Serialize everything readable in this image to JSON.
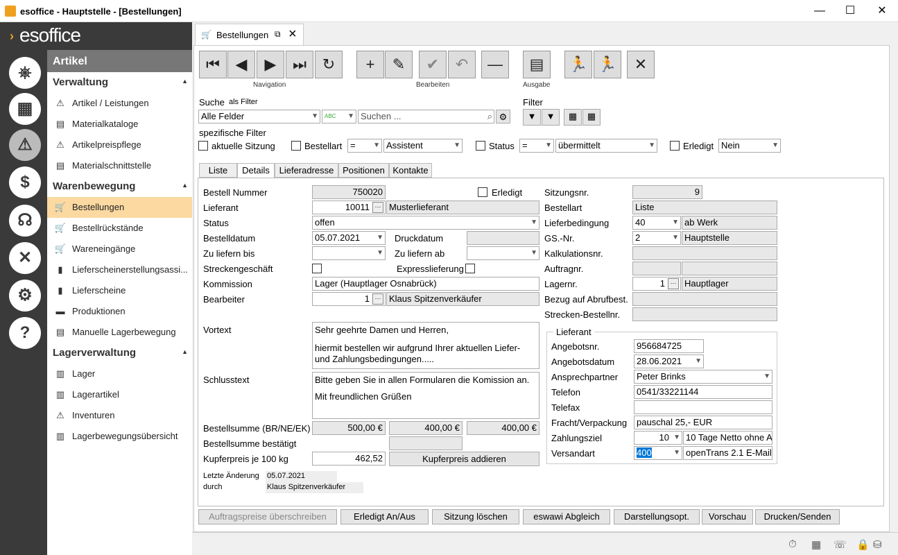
{
  "window": {
    "title": "esoffice - Hauptstelle - [Bestellungen]",
    "min": "—",
    "max": "☐",
    "close": "✕"
  },
  "logo": "esoffice",
  "sidebar": {
    "header": "Artikel",
    "sections": [
      {
        "title": "Verwaltung",
        "items": [
          "Artikel / Leistungen",
          "Materialkataloge",
          "Artikelpreispflege",
          "Materialschnittstelle"
        ]
      },
      {
        "title": "Warenbewegung",
        "items": [
          "Bestellungen",
          "Bestellrückstände",
          "Wareneingänge",
          "Lieferscheinerstellungsassi...",
          "Lieferscheine",
          "Produktionen",
          "Manuelle Lagerbewegung"
        ]
      },
      {
        "title": "Lagerverwaltung",
        "items": [
          "Lager",
          "Lagerartikel",
          "Inventuren",
          "Lagerbewegungsübersicht"
        ]
      }
    ]
  },
  "tab": {
    "label": "Bestellungen"
  },
  "toolbar": {
    "navigation": "Navigation",
    "bearbeiten": "Bearbeiten",
    "ausgabe": "Ausgabe"
  },
  "search": {
    "label": "Suche",
    "as_filter": "als Filter",
    "field": "Alle Felder",
    "placeholder": "Suchen ...",
    "filter": "Filter"
  },
  "spec_filter": {
    "title": "spezifische Filter",
    "aktuelle": "aktuelle Sitzung",
    "bestellart": "Bestellart",
    "bestellart_op": "=",
    "bestellart_val": "Assistent",
    "status": "Status",
    "status_op": "=",
    "status_val": "übermittelt",
    "erledigt": "Erledigt",
    "erledigt_val": "Nein"
  },
  "detail_tabs": [
    "Liste",
    "Details",
    "Lieferadresse",
    "Positionen",
    "Kontakte"
  ],
  "form": {
    "bestellnr_l": "Bestell Nummer",
    "bestellnr": "750020",
    "erledigt_l": "Erledigt",
    "lieferant_l": "Lieferant",
    "lieferant_nr": "10011",
    "lieferant_name": "Musterlieferant",
    "status_l": "Status",
    "status": "offen",
    "bestelldatum_l": "Bestelldatum",
    "bestelldatum": "05.07.2021",
    "druckdatum_l": "Druckdatum",
    "zuliefernbis_l": "Zu liefern bis",
    "zuliefernab_l": "Zu liefern ab",
    "strecken_l": "Streckengeschäft",
    "express_l": "Expresslieferung",
    "kommission_l": "Kommission",
    "kommission": "Lager (Hauptlager Osnabrück)",
    "bearbeiter_l": "Bearbeiter",
    "bearbeiter_nr": "1",
    "bearbeiter_name": "Klaus Spitzenverkäufer",
    "vortext_l": "Vortext",
    "vortext1": "Sehr geehrte Damen und Herren,",
    "vortext2": "hiermit bestellen wir aufgrund Ihrer aktuellen Liefer-",
    "vortext3": "und Zahlungsbedingungen.....",
    "schluss_l": "Schlusstext",
    "schluss1": "Bitte geben Sie in allen Formularen die Komission an.",
    "schluss2": "Mit freundlichen Grüßen",
    "summe_l": "Bestellsumme (BR/NE/EK)",
    "summe_br": "500,00 €",
    "summe_ne": "400,00 €",
    "summe_ek": "400,00 €",
    "summe_best_l": "Bestellsumme bestätigt",
    "kupfer_l": "Kupferpreis je 100 kg",
    "kupfer": "462,52",
    "kupfer_btn": "Kupferpreis addieren",
    "aend_l": "Letzte Änderung",
    "aend": "05.07.2021",
    "durch_l": "durch",
    "durch": "Klaus Spitzenverkäufer",
    "sitzung_l": "Sitzungsnr.",
    "sitzung": "9",
    "bestellart_l": "Bestellart",
    "bestellart": "Liste",
    "lieferbed_l": "Lieferbedingung",
    "lieferbed": "40",
    "lieferbed_txt": "ab Werk",
    "gs_l": "GS.-Nr.",
    "gs": "2",
    "gs_txt": "Hauptstelle",
    "kalk_l": "Kalkulationsnr.",
    "auftrag_l": "Auftragnr.",
    "lager_l": "Lagernr.",
    "lager": "1",
    "lager_txt": "Hauptlager",
    "abruf_l": "Bezug auf Abrufbest.",
    "strecken_best_l": "Strecken-Bestellnr.",
    "lief_group": "Lieferant",
    "angebot_l": "Angebotsnr.",
    "angebot": "956684725",
    "angebotsdat_l": "Angebotsdatum",
    "angebotsdat": "28.06.2021",
    "ansprech_l": "Ansprechpartner",
    "ansprech": "Peter Brinks",
    "telefon_l": "Telefon",
    "telefon": "0541/33221144",
    "telefax_l": "Telefax",
    "fracht_l": "Fracht/Verpackung",
    "fracht": "pauschal 25,- EUR",
    "zahlung_l": "Zahlungsziel",
    "zahlung": "10",
    "zahlung_txt": "10 Tage Netto ohne A",
    "versand_l": "Versandart",
    "versand": "400",
    "versand_txt": "openTrans 2.1 E-Mail"
  },
  "buttons": [
    "Auftragspreise überschreiben",
    "Erledigt An/Aus",
    "Sitzung löschen",
    "eswawi Abgleich",
    "Darstellungsopt.",
    "Vorschau",
    "Drucken/Senden"
  ]
}
